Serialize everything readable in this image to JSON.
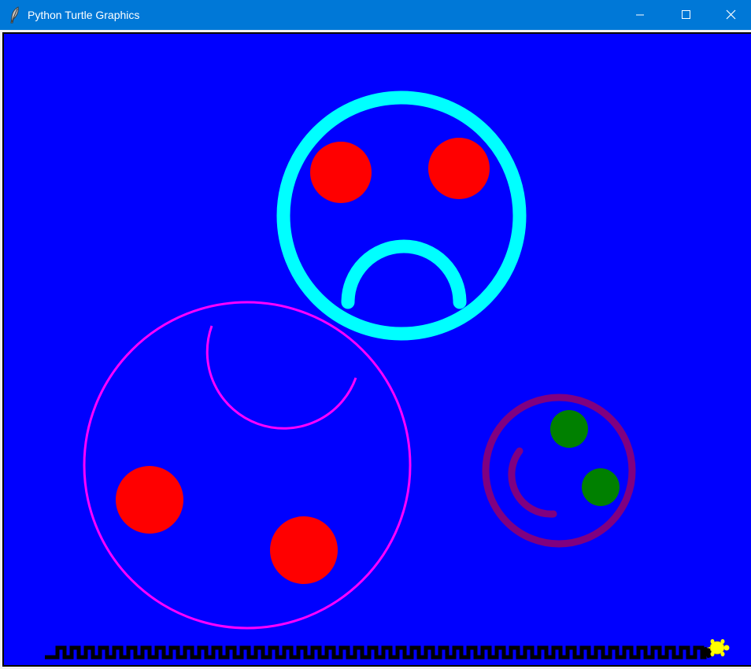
{
  "window": {
    "title": "Python Turtle Graphics",
    "titlebar_color": "#0078d7",
    "icons": {
      "app": "feather-icon",
      "minimize": "minimize-icon",
      "maximize": "maximize-icon",
      "close": "close-icon"
    }
  },
  "canvas": {
    "background": "#0000ff",
    "colors": {
      "sad_face": "#00ffff",
      "eyes": "#ff0000",
      "magenta_face": "#ff00ff",
      "purple_face": "#800080",
      "green_eyes": "#008000",
      "border_pattern": "#000000",
      "turtle": "#ffff00"
    }
  }
}
